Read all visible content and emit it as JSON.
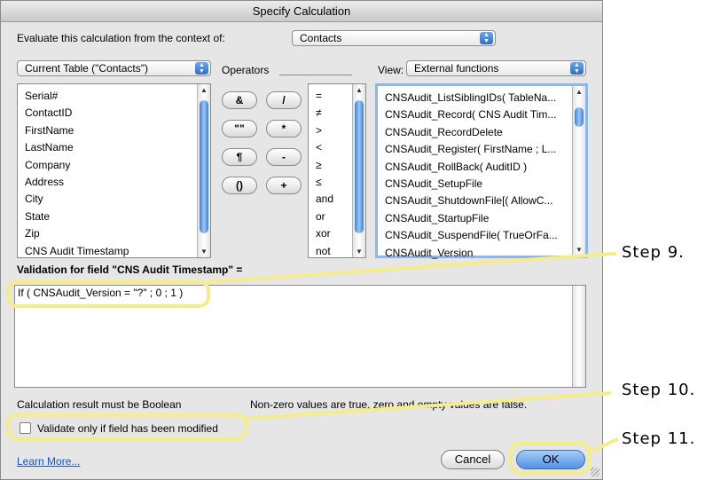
{
  "dialog": {
    "title": "Specify Calculation",
    "context_label": "Evaluate this calculation from the context of:",
    "context_value": "Contacts"
  },
  "fields_panel": {
    "table_selector": "Current Table (\"Contacts\")",
    "fields": [
      "Serial#",
      "ContactID",
      "FirstName",
      "LastName",
      "Company",
      "Address",
      "City",
      "State",
      "Zip",
      "CNS Audit Timestamp"
    ]
  },
  "operators_panel": {
    "label": "Operators",
    "buttons": [
      "&",
      "/",
      "\"\"",
      "*",
      "¶",
      "-",
      "()",
      "+"
    ],
    "list": [
      "=",
      "≠",
      ">",
      "<",
      "≥",
      "≤",
      "and",
      "or",
      "xor",
      "not"
    ]
  },
  "functions_panel": {
    "view_label": "View:",
    "view_value": "External functions",
    "functions": [
      "CNSAudit_ListSiblingIDs( TableNa...",
      "CNSAudit_Record( CNS Audit Tim...",
      "CNSAudit_RecordDelete",
      "CNSAudit_Register( FirstName ; L...",
      "CNSAudit_RollBack( AuditID )",
      "CNSAudit_SetupFile",
      "CNSAudit_ShutdownFile[( AllowC...",
      "CNSAudit_StartupFile",
      "CNSAudit_SuspendFile( TrueOrFa...",
      "CNSAudit_Version"
    ]
  },
  "formula": {
    "heading": "Validation for field \"CNS Audit Timestamp\" =",
    "text": "If ( CNSAudit_Version = \"?\" ; 0 ; 1 )"
  },
  "footer": {
    "result_note": "Calculation result must be Boolean",
    "bool_note": "Non-zero values are true, zero and empty values are false.",
    "checkbox_label": "Validate only if field has been modified",
    "checkbox_checked": false,
    "learn_more": "Learn More...",
    "cancel": "Cancel",
    "ok": "OK"
  },
  "annotations": {
    "step9": "Step 9.",
    "step10": "Step 10.",
    "step11": "Step 11."
  },
  "colors": {
    "highlight": "#f5ec8a",
    "default_button": "#5a9be8"
  }
}
